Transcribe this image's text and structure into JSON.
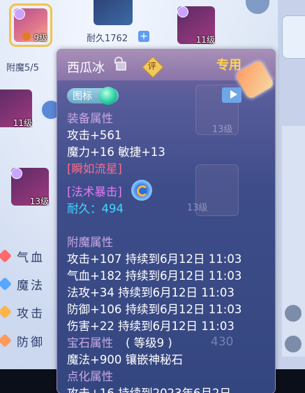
{
  "background": {
    "durability_label": "耐久1762",
    "enchant_label": "附魔5/5",
    "inventory_levels": [
      "9级",
      "11级",
      "11级",
      "13级"
    ],
    "ghost_levels": [
      "13级",
      "13级"
    ],
    "stat_labels": [
      "气血",
      "魔法",
      "攻击",
      "防御"
    ],
    "ghost_number": "430"
  },
  "tooltip": {
    "name": "西瓜冰",
    "evaluate_label": "评",
    "exclusive_label": "专用",
    "icon_button_label": "图标",
    "equip_section_title": "装备属性",
    "attack_line": "攻击+561",
    "magic_line": "魔力+16 敏捷+13",
    "special_effect": "[瞬如流星]",
    "skill": "[法术暴击]",
    "durability_line": "耐久：494",
    "enchant_section_title": "附魔属性",
    "enchant_lines": [
      "攻击+107 持续到6月12日 11:03",
      "气血+182 持续到6月12日 11:03",
      "法攻+34 持续到6月12日 11:03",
      "防御+106 持续到6月12日 11:03",
      "伤害+22 持续到6月12日 11:03"
    ],
    "gem_section_title": "宝石属性",
    "gem_level": "( 等级9 )",
    "gem_line": "魔法+900 镶嵌神秘石",
    "refine_section_title": "点化属性",
    "refine_partial_line": "攻击+16 持续到2023年6月2日"
  },
  "colors": {
    "section_title": "#c9a7e4",
    "special_red": "#ff6b8b",
    "skill_purple": "#e27cf2",
    "durability_cyan": "#42d6ff",
    "exclusive_gold": "#ffd44f",
    "selected_border": "#f3c24c"
  }
}
